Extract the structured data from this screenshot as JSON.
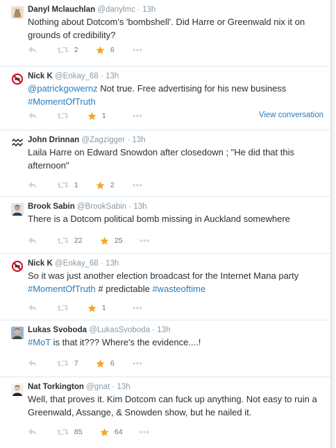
{
  "tweets": [
    {
      "avatar": "cat-avatar",
      "fullname": "Danyl Mclauchlan",
      "username": "@danylmc",
      "time": "13h",
      "text_parts": [
        {
          "t": "Nothing about Dotcom's 'bombshell'. Did Harre or Greenwald nix it on grounds of credibility?",
          "link": false
        }
      ],
      "retweets": "2",
      "favorites": "6"
    },
    {
      "avatar": "no-sign-avatar",
      "fullname": "Nick K",
      "username": "@Enkay_68",
      "time": "13h",
      "text_parts": [
        {
          "t": "@patrickgowernz",
          "link": true
        },
        {
          "t": " Not true. Free advertising for his new business ",
          "link": false
        },
        {
          "t": "#MomentOfTruth",
          "link": true
        }
      ],
      "retweets": "",
      "favorites": "1",
      "view_conversation": "View conversation"
    },
    {
      "avatar": "wave-logo-avatar",
      "fullname": "John Drinnan",
      "username": "@Zagzigger",
      "time": "13h",
      "text_parts": [
        {
          "t": "Laila Harre on Edward Snowdon after closedown ; \"He did that this afternoon\"",
          "link": false
        }
      ],
      "retweets": "1",
      "favorites": "2"
    },
    {
      "avatar": "person-photo-avatar",
      "fullname": "Brook Sabin",
      "username": "@BrookSabin",
      "time": "13h",
      "text_parts": [
        {
          "t": "There is a Dotcom political bomb missing in Auckland somewhere",
          "link": false
        }
      ],
      "retweets": "22",
      "favorites": "25"
    },
    {
      "avatar": "no-sign-avatar",
      "fullname": "Nick K",
      "username": "@Enkay_68",
      "time": "13h",
      "text_parts": [
        {
          "t": "So it was just another election broadcast for the Internet Mana party ",
          "link": false
        },
        {
          "t": "#MomentOfTruth",
          "link": true
        },
        {
          "t": " # predictable ",
          "link": false
        },
        {
          "t": "#wasteoftime",
          "link": true
        }
      ],
      "retweets": "",
      "favorites": "1"
    },
    {
      "avatar": "person-photo-avatar",
      "fullname": "Lukas Svoboda",
      "username": "@LukasSvoboda",
      "time": "13h",
      "text_parts": [
        {
          "t": "#MoT",
          "link": true
        },
        {
          "t": " is that it??? Where's the evidence....!",
          "link": false
        }
      ],
      "retweets": "7",
      "favorites": "6"
    },
    {
      "avatar": "person-photo-avatar",
      "fullname": "Nat Torkington",
      "username": "@gnat",
      "time": "13h",
      "text_parts": [
        {
          "t": "Well, that proves it. Kim Dotcom can fuck up anything. Not easy to ruin a Greenwald, Assange, & Snowden show, but he nailed it.",
          "link": false
        }
      ],
      "retweets": "85",
      "favorites": "64"
    }
  ],
  "colors": {
    "link": "#2b7bb9",
    "favorite_star": "#f5a623",
    "muted": "#8899a6"
  }
}
